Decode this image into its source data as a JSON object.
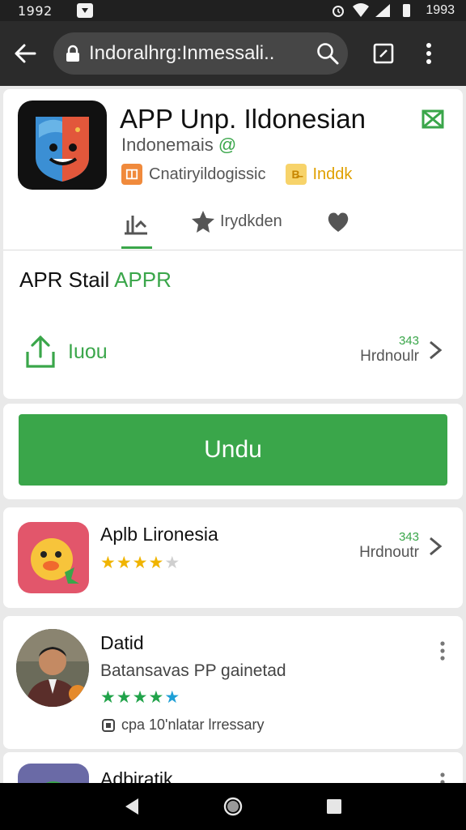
{
  "status_bar": {
    "time": "1992",
    "clock": "1993"
  },
  "browser": {
    "url": "Indoralhrg:Inmessali..",
    "url_truncated_note": ""
  },
  "app": {
    "title": "APP Unp. Ildonesian",
    "developer": "Indonemais",
    "developer_badge": "@",
    "tag1": "Cnatiryildogissic",
    "tag2": "Inddk",
    "tag2_icon_text": "B̶",
    "tab_reviews_label": "Irydkden",
    "section_title_main": "APR Stail ",
    "section_title_accent": "APPR",
    "share_label": "Iuou",
    "size": "343",
    "size_label": "Hrdnoulr",
    "install_label": "Undu"
  },
  "list": [
    {
      "name": "Aplb Lironesia",
      "rating_on": "★★★★",
      "rating_off": "★",
      "size": "343",
      "size_label": "Hrdnoutr"
    },
    {
      "name": "Datid",
      "subtitle": "Batansavas PP gainetad",
      "rating_on": "★★★★",
      "rating_blue": "★",
      "footer": "cpa 10'nlatar lrressary"
    },
    {
      "name": "Adbiratik"
    }
  ],
  "colors": {
    "accent": "#3aa64a",
    "toolbar": "#2b2b2b",
    "url_field": "#464646",
    "star_gold": "#f0b400"
  }
}
